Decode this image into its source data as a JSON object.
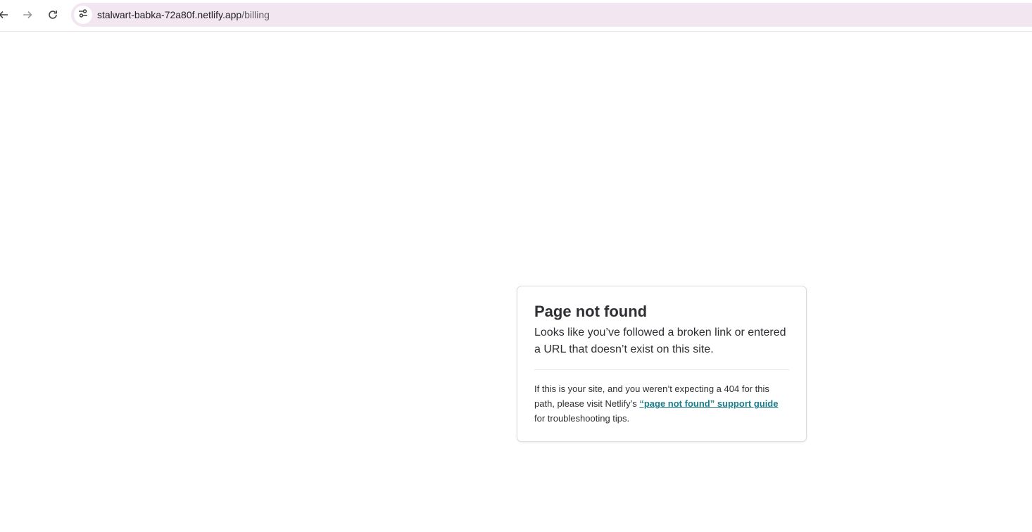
{
  "browser": {
    "url_host": "stalwart-babka-72a80f.netlify.app",
    "url_path": "/billing",
    "icons": {
      "back": "back-arrow-icon",
      "forward": "forward-arrow-icon",
      "reload": "reload-icon",
      "site_info": "tune-icon"
    }
  },
  "error_card": {
    "title": "Page not found",
    "lead": "Looks like you’ve followed a broken link or entered a URL that doesn’t exist on this site.",
    "help_prefix": "If this is your site, and you weren’t expecting a 404 for this path, please visit Netlify’s ",
    "help_link": "“page not found” support guide",
    "help_suffix": " for troubleshooting tips."
  },
  "colors": {
    "omnibox_bg": "#f2e6f0",
    "link": "#1b7c8a",
    "text": "#2d2f33"
  }
}
